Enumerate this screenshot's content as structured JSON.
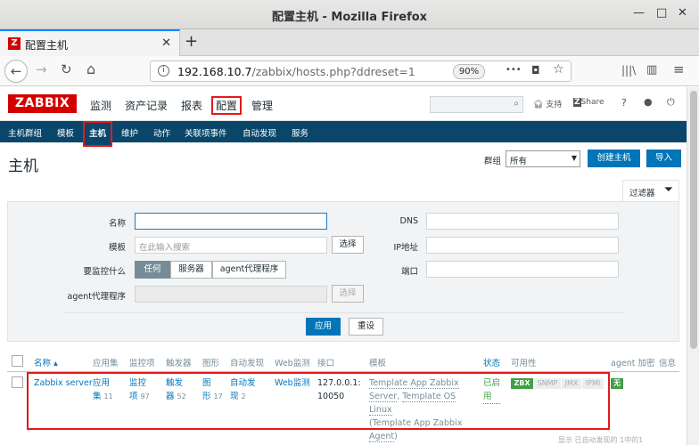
{
  "window": {
    "title": "配置主机 - Mozilla Firefox",
    "minimize": "—",
    "maximize": "□",
    "close": "✕"
  },
  "tab": {
    "title": "配置主机",
    "favicon": "Z",
    "close": "✕",
    "new_tab": "+"
  },
  "nav": {
    "back": "←",
    "forward": "→",
    "reload": "↻",
    "home": "⌂",
    "url_host": "192.168.10.7",
    "url_rest": "/zabbix/hosts.php?ddreset=1",
    "zoom": "90%",
    "more": "•••",
    "pocket": "◘",
    "star": "☆",
    "library": "|||\\",
    "sidebar": "▥",
    "menu": "≡"
  },
  "zabbix": {
    "logo": "ZABBIX",
    "menu": [
      "监测",
      "资产记录",
      "报表",
      "配置",
      "管理"
    ],
    "support": "支持",
    "share": "Share",
    "help": "?",
    "user": "👤",
    "logout": "⏻",
    "search_icon": "🔍",
    "submenu": [
      "主机群组",
      "模板",
      "主机",
      "维护",
      "动作",
      "关联项事件",
      "自动发现",
      "服务"
    ]
  },
  "page": {
    "title": "主机",
    "group_label": "群组",
    "group_value": "所有",
    "create_button": "创建主机",
    "import_button": "导入"
  },
  "filter": {
    "tab_label": "过滤器",
    "name_label": "名称",
    "template_label": "模板",
    "template_placeholder": "在此输入搜索",
    "select_button": "选择",
    "monitored_by_label": "要监控什么",
    "monitored_by_options": [
      "任何",
      "服务器",
      "agent代理程序"
    ],
    "proxy_label": "agent代理程序",
    "proxy_select_button": "选择",
    "dns_label": "DNS",
    "ip_label": "IP地址",
    "port_label": "端口",
    "apply_button": "应用",
    "reset_button": "重设"
  },
  "table": {
    "headers": {
      "name": "名称 ▴",
      "applications": "应用集",
      "items": "监控项",
      "triggers": "触发器",
      "graphs": "图形",
      "discovery": "自动发现",
      "web": "Web监测",
      "interface": "接口",
      "templates": "模板",
      "status": "状态",
      "availability": "可用性",
      "encryption": "agent 加密",
      "info": "信息"
    },
    "row": {
      "name": "Zabbix server",
      "applications_l1": "应用",
      "applications_l2": "集",
      "applications_count": "11",
      "items_l1": "监控",
      "items_l2": "项",
      "items_count": "97",
      "triggers_l1": "触发",
      "triggers_l2": "器",
      "triggers_count": "52",
      "graphs_l1": "图",
      "graphs_l2": "形",
      "graphs_count": "17",
      "discovery_l1": "自动发",
      "discovery_l2": "现",
      "discovery_count": "2",
      "web": "Web监测",
      "interface_l1": "127.0.0.1:",
      "interface_l2": "10050",
      "templates_l1": "Template App Zabbix",
      "templates_l2a": "Server",
      "templates_l2b": "Template OS Linux",
      "templates_l3": "Template App Zabbix",
      "templates_l4": "Agent",
      "status_l1": "已启",
      "status_l2": "用",
      "availability": [
        "ZBX",
        "SNMP",
        "JMX",
        "IPMI"
      ],
      "encryption": "无"
    },
    "footer": "显示 已自动发现的 1中的1"
  },
  "colors": {
    "brand_red": "#d40000",
    "nav_blue": "#0a466a",
    "button_blue": "#0275b8",
    "green": "#429e47",
    "highlight_red": "#e01b1b"
  }
}
